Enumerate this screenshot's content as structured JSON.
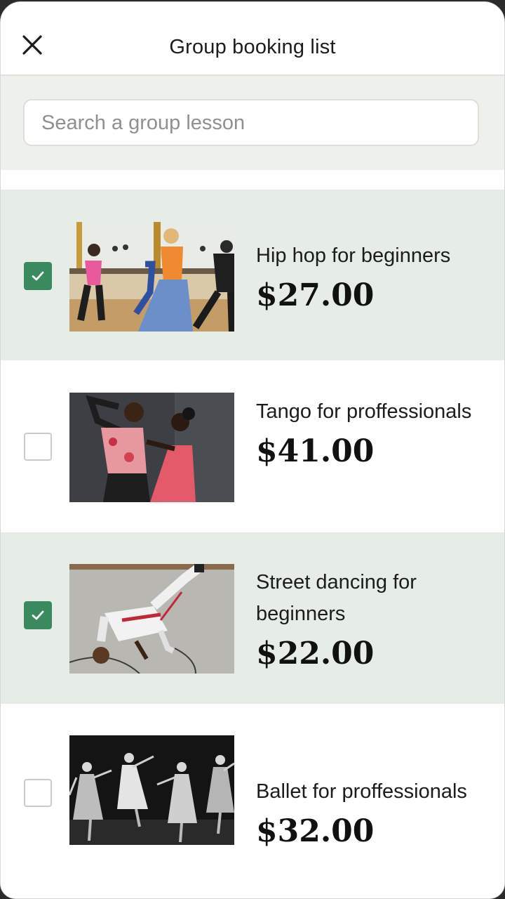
{
  "header": {
    "title": "Group booking list"
  },
  "search": {
    "placeholder": "Search a group lesson",
    "value": ""
  },
  "items": [
    {
      "name": "Hip hop for beginners",
      "price": "$27.00",
      "checked": true
    },
    {
      "name": "Tango for proffessionals",
      "price": "$41.00",
      "checked": false
    },
    {
      "name": "Street dancing for beginners",
      "price": "$22.00",
      "checked": true
    },
    {
      "name": "Ballet for proffessionals",
      "price": "$32.00",
      "checked": false
    }
  ],
  "colors": {
    "accent": "#3b8a5f",
    "selected_row": "#e6ede6",
    "search_band": "#eef0ec"
  }
}
